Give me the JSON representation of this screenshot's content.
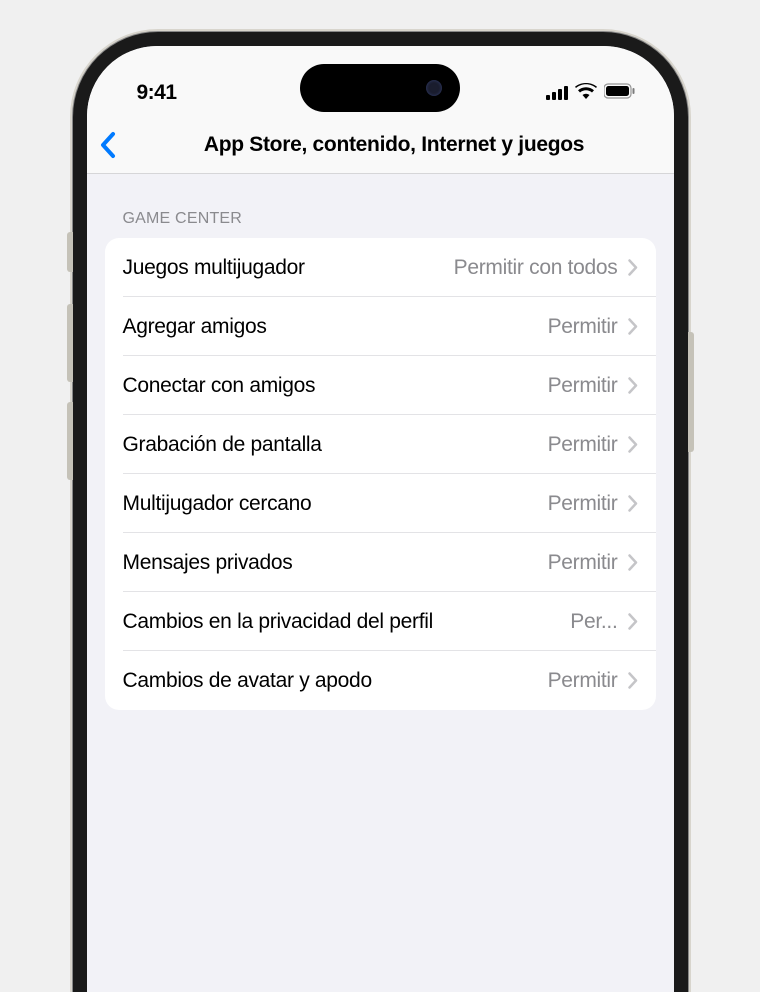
{
  "status": {
    "time": "9:41"
  },
  "nav": {
    "title": "App Store, contenido, Internet y juegos"
  },
  "section": {
    "header": "GAME CENTER",
    "items": [
      {
        "label": "Juegos multijugador",
        "value": "Permitir con todos"
      },
      {
        "label": "Agregar amigos",
        "value": "Permitir"
      },
      {
        "label": "Conectar con amigos",
        "value": "Permitir"
      },
      {
        "label": "Grabación de pantalla",
        "value": "Permitir"
      },
      {
        "label": "Multijugador cercano",
        "value": "Permitir"
      },
      {
        "label": "Mensajes privados",
        "value": "Permitir"
      },
      {
        "label": "Cambios en la privacidad del perfil",
        "value": "Per..."
      },
      {
        "label": "Cambios de avatar y apodo",
        "value": "Permitir"
      }
    ]
  }
}
